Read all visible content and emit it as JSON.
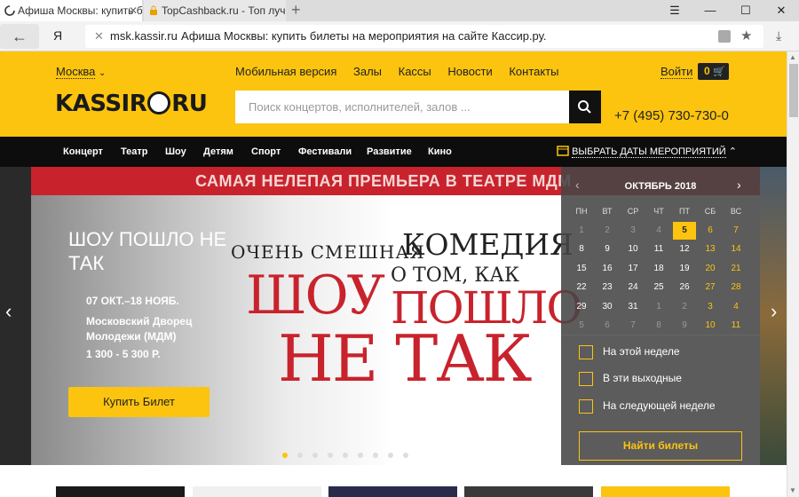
{
  "browser": {
    "tabs": [
      {
        "title": "Афиша Москвы: купить б"
      },
      {
        "title": "TopCashback.ru - Топ лучш"
      }
    ],
    "yandex_label": "Я",
    "address": {
      "domain": "msk.kassir.ru",
      "page_title": "Афиша Москвы: купить билеты на мероприятия на сайте Кассир.ру."
    }
  },
  "header": {
    "city": "Москва",
    "top_links": [
      "Мобильная версия",
      "Залы",
      "Кассы",
      "Новости",
      "Контакты"
    ],
    "login": "Войти",
    "cart_count": "0",
    "logo_left": "KASSIR",
    "logo_right": "RU",
    "search_placeholder": "Поиск концертов, исполнителей, залов ...",
    "phone": "+7 (495) 730-730-0"
  },
  "nav": {
    "items": [
      "Концерт",
      "Театр",
      "Шоу",
      "Детям",
      "Спорт",
      "Фестивали",
      "Развитие",
      "Кино"
    ],
    "date_picker_label": "ВЫБРАТЬ ДАТЫ МЕРОПРИЯТИЙ"
  },
  "banner": {
    "top_strip": "САМАЯ НЕЛЕПАЯ ПРЕМЬЕРА В ТЕАТРЕ МДМ",
    "title": "ШОУ ПОШЛО НЕ ТАК",
    "dates": "07 ОКТ.–18 НОЯБ.",
    "venue": "Московский Дворец Молодежи (МДМ)",
    "price": "1 300 - 5 300 Р.",
    "buy_button": "Купить Билет",
    "poster_line1": "ОЧЕНЬ СМЕШНАЯ",
    "poster_line2": "КОМЕДИЯ",
    "poster_line3": "О ТОМ, КАК",
    "poster_line4": "ШОУ",
    "poster_line5": "ПОШЛО",
    "poster_line6": "НЕ ТАК",
    "slide_count": 9,
    "active_slide": 1
  },
  "calendar": {
    "month": "ОКТЯБРЬ 2018",
    "weekdays": [
      "ПН",
      "ВТ",
      "СР",
      "ЧТ",
      "ПТ",
      "СБ",
      "ВС"
    ],
    "weeks": [
      [
        "1",
        "2",
        "3",
        "4",
        "5",
        "6",
        "7"
      ],
      [
        "8",
        "9",
        "10",
        "11",
        "12",
        "13",
        "14"
      ],
      [
        "15",
        "16",
        "17",
        "18",
        "19",
        "20",
        "21"
      ],
      [
        "22",
        "23",
        "24",
        "25",
        "26",
        "27",
        "28"
      ],
      [
        "29",
        "30",
        "31",
        "1",
        "2",
        "3",
        "4"
      ],
      [
        "5",
        "6",
        "7",
        "8",
        "9",
        "10",
        "11"
      ]
    ],
    "today": "5",
    "filters": [
      "На этой неделе",
      "В эти выходные",
      "На следующей неделе"
    ],
    "find_button": "Найти билеты"
  },
  "colors": {
    "brand_yellow": "#fcc40e",
    "nav_black": "#0d0d0d",
    "accent_red": "#c8232c"
  }
}
